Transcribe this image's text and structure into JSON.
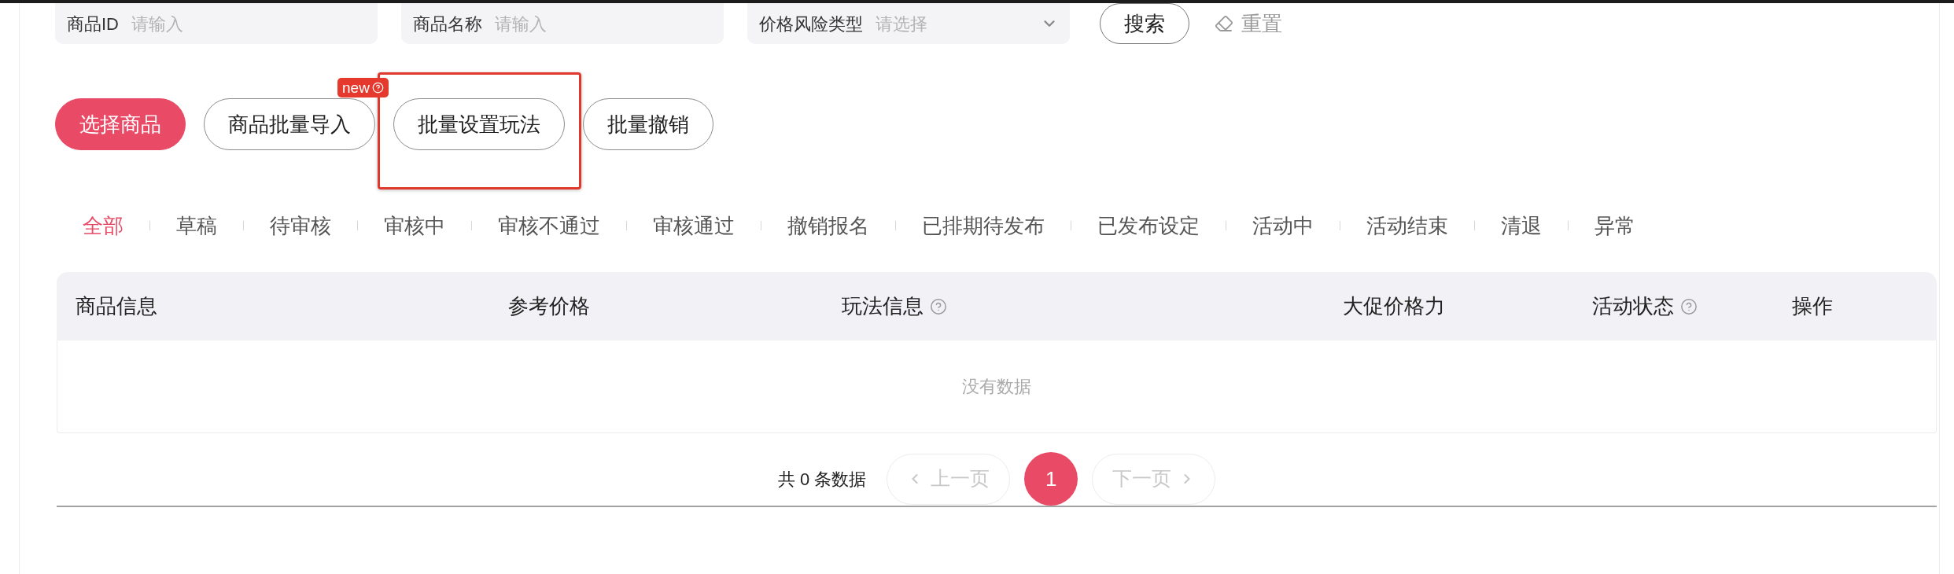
{
  "filters": [
    {
      "kind": "input",
      "label": "商品ID",
      "placeholder": "请输入"
    },
    {
      "kind": "input",
      "label": "商品名称",
      "placeholder": "请输入"
    },
    {
      "kind": "select",
      "label": "价格风险类型",
      "placeholder": "请选择"
    }
  ],
  "search_button": "搜索",
  "reset_button": "重置",
  "action_buttons": [
    {
      "label": "选择商品",
      "kind": "primary",
      "highlighted": false
    },
    {
      "label": "商品批量导入",
      "kind": "outline",
      "badge": "new",
      "highlighted": false
    },
    {
      "label": "批量设置玩法",
      "kind": "outline",
      "highlighted": true
    },
    {
      "label": "批量撤销",
      "kind": "outline",
      "highlighted": false
    }
  ],
  "tabs": [
    {
      "label": "全部",
      "selected": true
    },
    {
      "label": "草稿",
      "selected": false
    },
    {
      "label": "待审核",
      "selected": false
    },
    {
      "label": "审核中",
      "selected": false
    },
    {
      "label": "审核不通过",
      "selected": false
    },
    {
      "label": "审核通过",
      "selected": false
    },
    {
      "label": "撤销报名",
      "selected": false
    },
    {
      "label": "已排期待发布",
      "selected": false
    },
    {
      "label": "已发布设定",
      "selected": false
    },
    {
      "label": "活动中",
      "selected": false
    },
    {
      "label": "活动结束",
      "selected": false
    },
    {
      "label": "清退",
      "selected": false
    },
    {
      "label": "异常",
      "selected": false
    }
  ],
  "table": {
    "columns": [
      {
        "label": "商品信息",
        "help": false
      },
      {
        "label": "参考价格",
        "help": false
      },
      {
        "label": "玩法信息",
        "help": true
      },
      {
        "label": "大促价格力",
        "help": false
      },
      {
        "label": "活动状态",
        "help": true
      },
      {
        "label": "操作",
        "help": false
      }
    ],
    "empty_text": "没有数据"
  },
  "pagination": {
    "total": "共 0 条数据",
    "prev": {
      "label": "上一页",
      "disabled": true
    },
    "pages": [
      {
        "label": "1",
        "selected": true
      }
    ],
    "next": {
      "label": "下一页",
      "disabled": true
    }
  }
}
